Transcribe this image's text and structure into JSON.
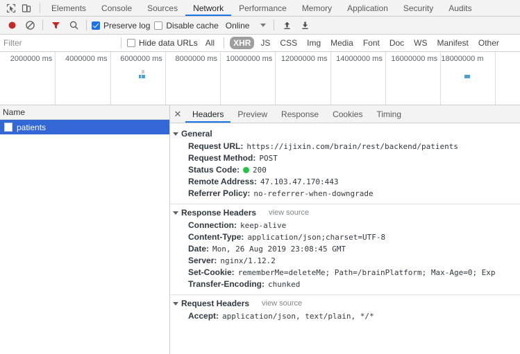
{
  "window": {
    "inspect_icon": "inspect-cursor-icon",
    "device_toolbar_icon": "device-toolbar-icon"
  },
  "main_tabs": [
    {
      "label": "Elements",
      "selected": false
    },
    {
      "label": "Console",
      "selected": false
    },
    {
      "label": "Sources",
      "selected": false
    },
    {
      "label": "Network",
      "selected": true
    },
    {
      "label": "Performance",
      "selected": false
    },
    {
      "label": "Memory",
      "selected": false
    },
    {
      "label": "Application",
      "selected": false
    },
    {
      "label": "Security",
      "selected": false
    },
    {
      "label": "Audits",
      "selected": false
    }
  ],
  "toolbar": {
    "record_icon": "record-icon",
    "clear_icon": "clear-icon",
    "filter_icon": "filter-funnel-icon",
    "search_icon": "search-icon",
    "preserve_log_label": "Preserve log",
    "preserve_log_checked": true,
    "disable_cache_label": "Disable cache",
    "disable_cache_checked": false,
    "throttling_value": "Online",
    "throttling_caret_icon": "chevron-down-icon",
    "import_icon": "import-har-icon",
    "export_icon": "export-har-icon"
  },
  "filterbar": {
    "filter_placeholder": "Filter",
    "filter_value": "",
    "hide_data_urls_label": "Hide data URLs",
    "hide_data_urls_checked": false,
    "types": [
      {
        "label": "All",
        "active": false
      },
      {
        "label": "XHR",
        "active": true
      },
      {
        "label": "JS",
        "active": false
      },
      {
        "label": "CSS",
        "active": false
      },
      {
        "label": "Img",
        "active": false
      },
      {
        "label": "Media",
        "active": false
      },
      {
        "label": "Font",
        "active": false
      },
      {
        "label": "Doc",
        "active": false
      },
      {
        "label": "WS",
        "active": false
      },
      {
        "label": "Manifest",
        "active": false
      },
      {
        "label": "Other",
        "active": false
      }
    ]
  },
  "chart_data": {
    "type": "bar",
    "title": "",
    "xlabel": "",
    "ylabel": "",
    "grid": true,
    "tick_labels": [
      "2000000 ms",
      "4000000 ms",
      "6000000 ms",
      "8000000 ms",
      "10000000 ms",
      "12000000 ms",
      "14000000 ms",
      "16000000 ms",
      "18000000 m"
    ],
    "tick_values": [
      2000000,
      4000000,
      6000000,
      8000000,
      10000000,
      12000000,
      14000000,
      16000000,
      18000000
    ],
    "xlim": [
      0,
      18900000
    ],
    "requests": [
      {
        "start": 5150000,
        "end": 5250000,
        "y": 0,
        "color": "#c9cdd1"
      },
      {
        "start": 5050000,
        "end": 5120000,
        "y": 1,
        "color": "#4a9fd5"
      },
      {
        "start": 5150000,
        "end": 5270000,
        "y": 1,
        "color": "#4a9fd5"
      },
      {
        "start": 16880000,
        "end": 17080000,
        "y": 1,
        "color": "#4a9fd5"
      }
    ]
  },
  "request_list": {
    "column_header": "Name",
    "rows": [
      {
        "name": "patients",
        "selected": true,
        "icon": "document-icon"
      }
    ]
  },
  "details": {
    "close_icon": "close-icon",
    "tabs": [
      {
        "label": "Headers",
        "selected": true
      },
      {
        "label": "Preview",
        "selected": false
      },
      {
        "label": "Response",
        "selected": false
      },
      {
        "label": "Cookies",
        "selected": false
      },
      {
        "label": "Timing",
        "selected": false
      }
    ],
    "sections": [
      {
        "title": "General",
        "view_source": "",
        "rows": [
          {
            "name": "Request URL:",
            "value": "https://ijixin.com/brain/rest/backend/patients"
          },
          {
            "name": "Request Method:",
            "value": "POST"
          },
          {
            "name": "Status Code:",
            "value": "200",
            "status_dot": "#23c343"
          },
          {
            "name": "Remote Address:",
            "value": "47.103.47.170:443"
          },
          {
            "name": "Referrer Policy:",
            "value": "no-referrer-when-downgrade"
          }
        ]
      },
      {
        "title": "Response Headers",
        "view_source": "view source",
        "rows": [
          {
            "name": "Connection:",
            "value": "keep-alive"
          },
          {
            "name": "Content-Type:",
            "value": "application/json;charset=UTF-8"
          },
          {
            "name": "Date:",
            "value": "Mon, 26 Aug 2019 23:08:45 GMT"
          },
          {
            "name": "Server:",
            "value": "nginx/1.12.2"
          },
          {
            "name": "Set-Cookie:",
            "value": "rememberMe=deleteMe; Path=/brainPlatform; Max-Age=0; Exp"
          },
          {
            "name": "Transfer-Encoding:",
            "value": "chunked"
          }
        ]
      },
      {
        "title": "Request Headers",
        "view_source": "view source",
        "rows": [
          {
            "name": "Accept:",
            "value": "application/json, text/plain, */*"
          }
        ]
      }
    ]
  },
  "colors": {
    "accent": "#1a73e8",
    "selected_row": "#3367d6",
    "status_ok": "#23c343",
    "record": "#c62828",
    "filter_active": "#c62828",
    "timeline_bar": "#4a9fd5"
  }
}
